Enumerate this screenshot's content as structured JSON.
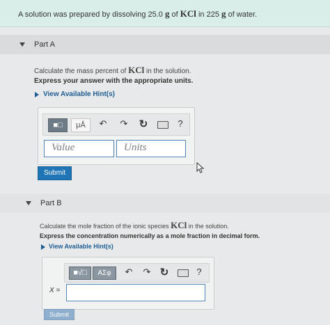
{
  "problem": {
    "text_before": "A solution was prepared by dissolving 25.0",
    "unit_g": "g",
    "text_of": "of",
    "formula": "KCl",
    "text_in": "in 225",
    "text_water": "of water."
  },
  "partA": {
    "label": "Part A",
    "question_before": "Calculate the mass percent of",
    "formula": "KCl",
    "question_after": "in the solution.",
    "instruction": "Express your answer with the appropriate units.",
    "hint": "View Available Hint(s)",
    "toolbar": {
      "template_btn": "■□",
      "mu_btn": "μÅ",
      "undo": "↶",
      "redo": "↷",
      "reset": "↻",
      "help": "?"
    },
    "value_placeholder": "Value",
    "units_placeholder": "Units",
    "submit": "Submit"
  },
  "partB": {
    "label": "Part B",
    "question_before": "Calculate the mole fraction of the ionic species",
    "formula": "KCl",
    "question_after": "in the solution.",
    "instruction": "Express the concentration numerically as a mole fraction in decimal form.",
    "hint": "View Available Hint(s)",
    "toolbar": {
      "template_btn": "■√□",
      "sigma_btn": "ΑΣφ",
      "undo": "↶",
      "redo": "↷",
      "reset": "↻",
      "help": "?"
    },
    "x_label": "X =",
    "submit": "Submit"
  }
}
